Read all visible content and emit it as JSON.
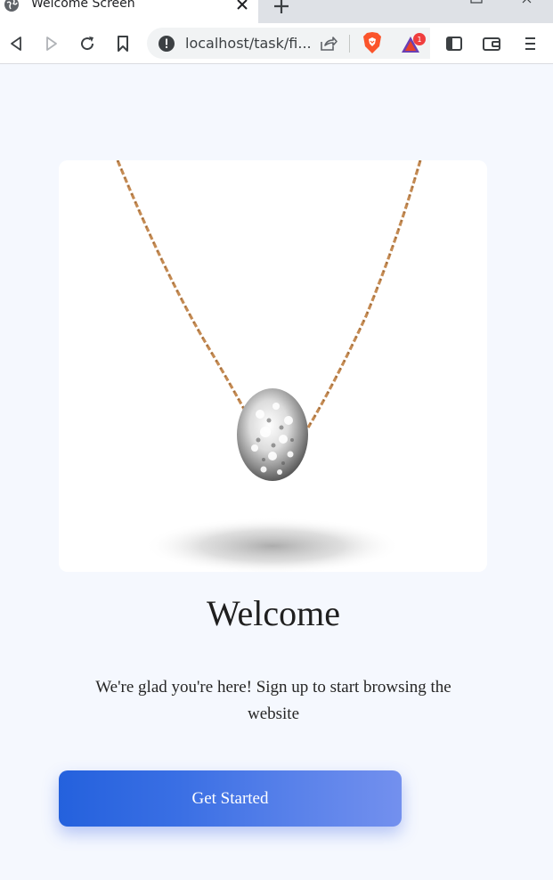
{
  "browser": {
    "tab_title": "Welcome Screen",
    "address_bar_url": "localhost/task/fi...",
    "rewards_badge_count": "1",
    "brave_color": "#fb542b",
    "rewards_badge_color": "#f03e3e"
  },
  "page": {
    "hero_image_alt": "pendant",
    "title": "Welcome",
    "subtitle": "We're glad you're here! Sign up to start browsing the website",
    "cta_label": "Get Started",
    "accent_gradient": [
      "#2461dd",
      "#7390ee"
    ],
    "background_color": "#f5f8fe"
  },
  "icons": {
    "favicon": "globe-icon",
    "tab_close": "close-icon",
    "new_tab": "plus-icon",
    "back": "back-arrow-icon",
    "forward": "forward-arrow-icon",
    "reload": "reload-icon",
    "bookmark": "bookmark-icon",
    "site_info": "info-icon",
    "share": "share-icon",
    "brave_shields": "brave-lion-icon",
    "rewards": "rewards-triangle-icon",
    "sidebar": "sidebar-icon",
    "wallet": "wallet-icon",
    "menu": "menu-icon"
  }
}
